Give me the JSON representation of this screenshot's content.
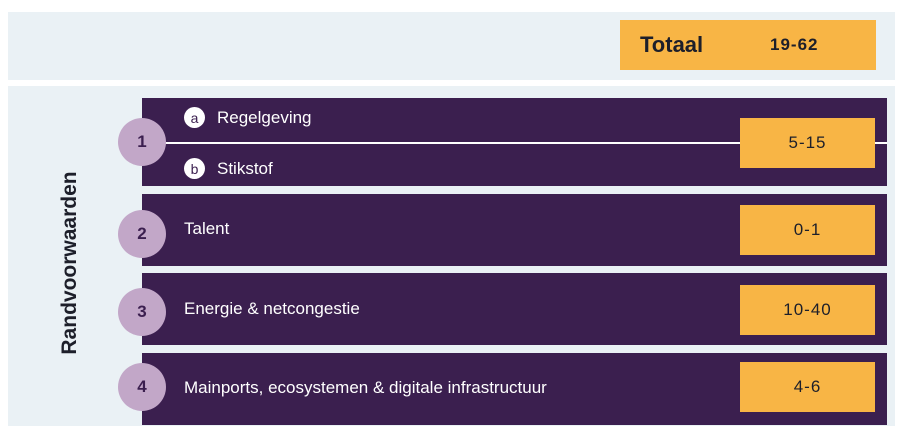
{
  "total": {
    "label": "Totaal",
    "value": "19-62"
  },
  "side_label": "Randvoorwaarden",
  "rows": [
    {
      "number": "1",
      "subitems": [
        {
          "letter": "a",
          "label": "Regelgeving"
        },
        {
          "letter": "b",
          "label": "Stikstof"
        }
      ],
      "value": "5-15"
    },
    {
      "number": "2",
      "label": "Talent",
      "value": "0-1"
    },
    {
      "number": "3",
      "label": "Energie & netcongestie",
      "value": "10-40"
    },
    {
      "number": "4",
      "label": "Mainports, ecosystemen & digitale infrastructuur",
      "value": "4-6"
    }
  ],
  "colors": {
    "row_bg": "#3b1f4f",
    "accent": "#f8b545",
    "number_circle": "#c2a7c8",
    "band_bg": "#eaf1f5"
  }
}
